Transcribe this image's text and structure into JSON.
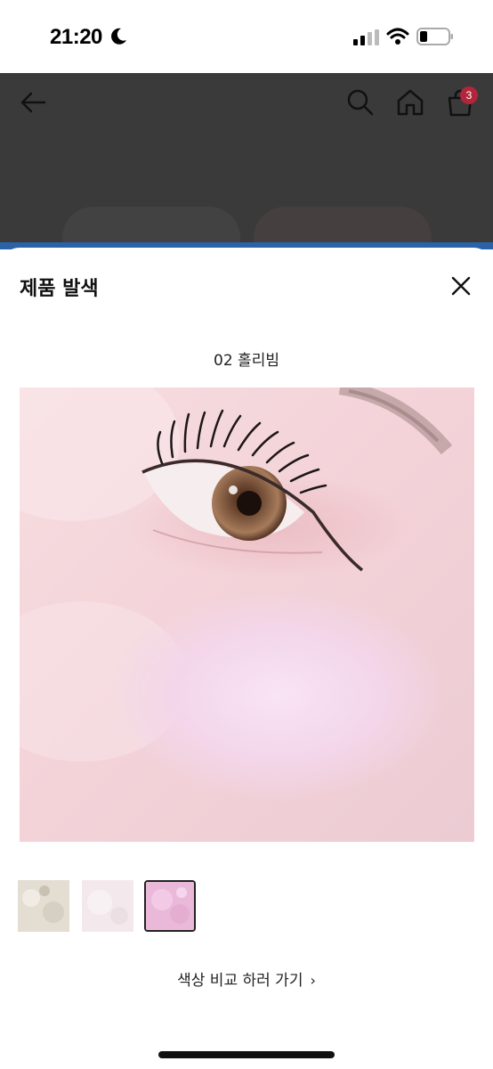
{
  "status_bar": {
    "time": "21:20"
  },
  "app_header": {
    "cart_count": "3"
  },
  "sheet": {
    "title": "제품 발색",
    "shade_name": "02 홀리빔",
    "compare_link": "색상 비교 하러 가기",
    "selected_thumbnail": 3
  },
  "colors": {
    "overlay": "#3a3a3a",
    "badge": "#b3253a",
    "accent_strip": "#2b63a8"
  }
}
